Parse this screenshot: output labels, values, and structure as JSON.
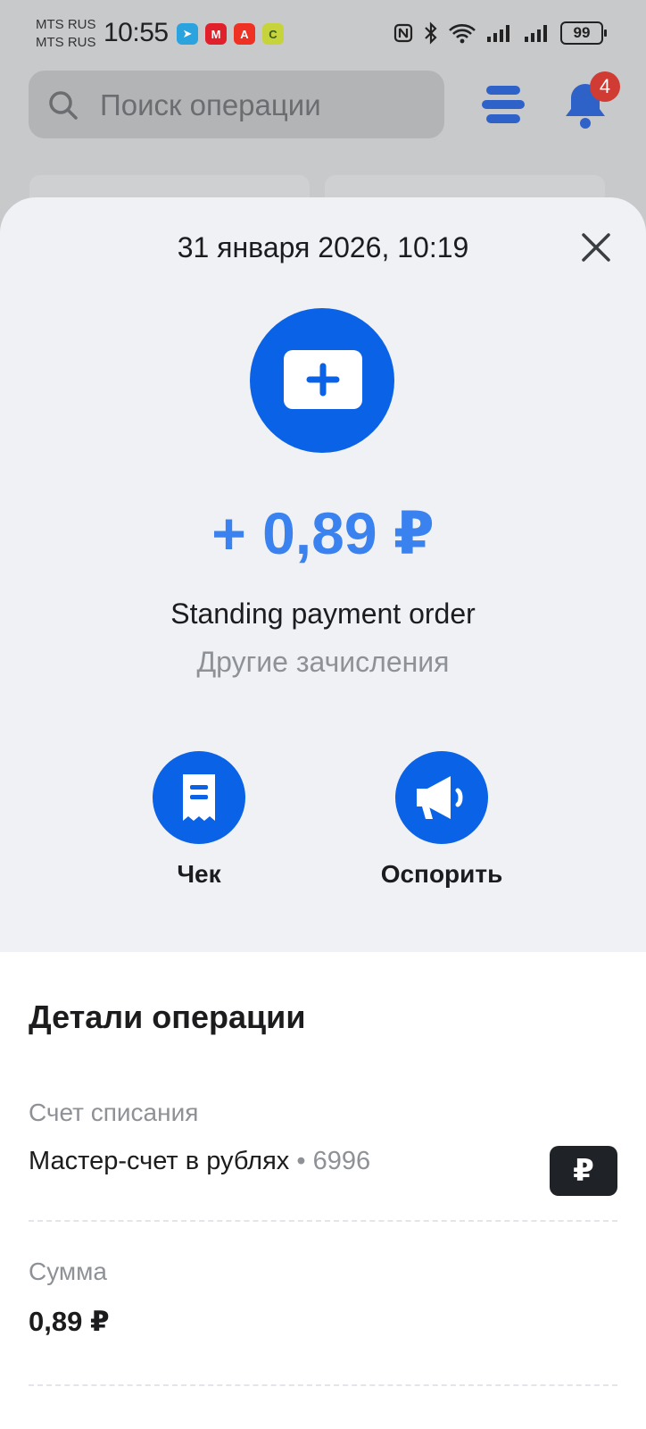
{
  "status_bar": {
    "carrier_1": "MTS RUS",
    "carrier_2": "MTS RUS",
    "time": "10:55",
    "battery": "99"
  },
  "top": {
    "search_placeholder": "Поиск операции",
    "notification_count": "4"
  },
  "sheet": {
    "date": "31 января 2026, 10:19",
    "amount": "+ 0,89 ₽",
    "title": "Standing payment order",
    "category": "Другие зачисления",
    "actions": [
      {
        "label": "Чек",
        "icon": "receipt-icon"
      },
      {
        "label": "Оспорить",
        "icon": "megaphone-icon"
      }
    ]
  },
  "details": {
    "title": "Детали операции",
    "account_label": "Счет списания",
    "account_name": "Мастер-счет в рублях",
    "account_number": "• 6996",
    "account_badge": "₽",
    "sum_label": "Сумма",
    "sum_value": "0,89 ₽"
  },
  "colors": {
    "accent": "#0a63e6",
    "amount": "#3a82f0",
    "badge": "#d03b33"
  }
}
